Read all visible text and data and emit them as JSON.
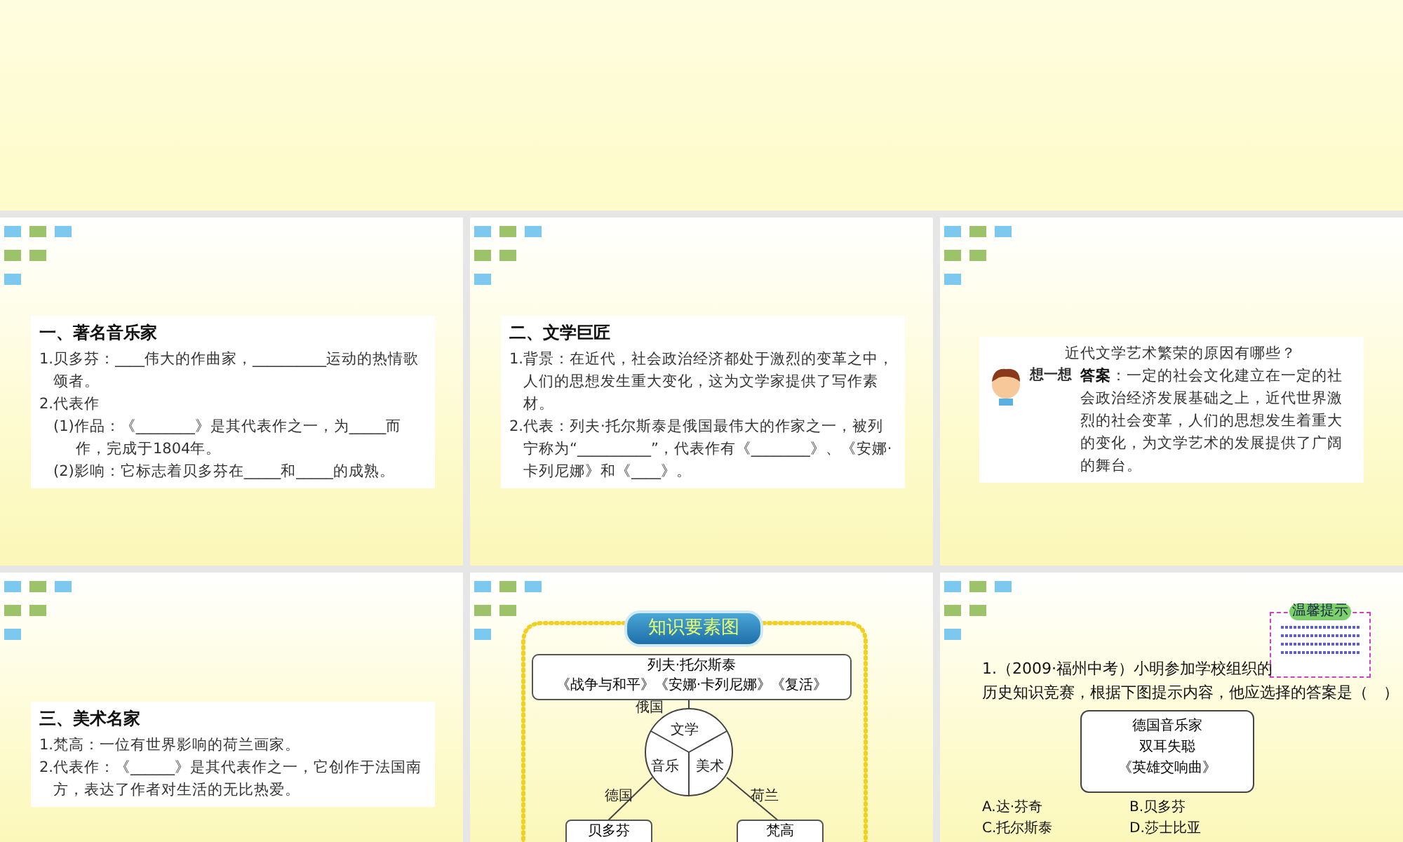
{
  "slides": [
    {
      "kind": "blank"
    },
    {
      "kind": "notes",
      "heading": "一、著名音乐家",
      "paragraphs": [
        {
          "kind": "item",
          "text": "1.贝多芬：____伟大的作曲家，__________运动的热情歌颂者。"
        },
        {
          "kind": "item",
          "text": "2.代表作"
        },
        {
          "kind": "sub",
          "text": "(1)作品：《________》是其代表作之一，为_____而作，完成于1804年。"
        },
        {
          "kind": "sub",
          "text": "(2)影响：它标志着贝多芬在_____和_____的成熟。"
        }
      ]
    },
    {
      "kind": "notes",
      "heading": "二、文学巨匠",
      "paragraphs": [
        {
          "kind": "item",
          "text": "1.背景：在近代，社会政治经济都处于激烈的变革之中，人们的思想发生重大变化，这为文学家提供了写作素材。"
        },
        {
          "kind": "item",
          "text": "2.代表：列夫·托尔斯泰是俄国最伟大的作家之一，被列宁称为“__________”，代表作有《________》、《安娜·卡列尼娜》和《____》。"
        }
      ]
    },
    {
      "kind": "think",
      "question": "近代文学艺术繁荣的原因有哪些？",
      "label": "想一想",
      "answer": "**答案**：一定的社会文化建立在一定的社会政治经济发展基础之上，近代世界激烈的社会变革，人们的思想发生着重大的变化，为文学艺术的发展提供了广阔的舞台。"
    },
    {
      "kind": "notes",
      "heading": "三、美术名家",
      "paragraphs": [
        {
          "kind": "item",
          "text": "1.梵高：一位有世界影响的荷兰画家。"
        },
        {
          "kind": "item",
          "text": "2.代表作：《______》是其代表作之一，它创作于法国南方，表达了作者对生活的无比热爱。"
        }
      ]
    },
    {
      "kind": "map",
      "title": "知识要素图",
      "top_box": [
        "列夫·托尔斯泰",
        "《战争与和平》《安娜·卡列尼娜》《复活》"
      ],
      "top_edge": "俄国",
      "sectors": [
        "文学",
        "音乐",
        "美术"
      ],
      "left_edge": "德国",
      "right_edge": "荷兰",
      "left_box": "贝多芬",
      "right_box": "梵高"
    },
    {
      "kind": "quiz",
      "hint_title": "温馨提示",
      "question": [
        "1.（2009·福州中考）小明参加学校组织的",
        "历史知识竞赛，根据下图提示内容，他应选择的答案是（　）"
      ],
      "scroll": [
        "德国音乐家",
        "双耳失聪",
        "《英雄交响曲》"
      ],
      "options": [
        "A.达·芬奇",
        "B.贝多芬",
        "C.托尔斯泰",
        "D.莎士比亚"
      ]
    }
  ]
}
